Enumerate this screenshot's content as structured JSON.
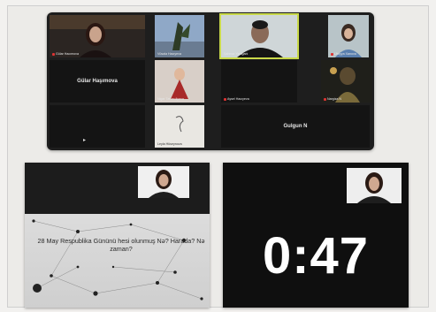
{
  "meeting": {
    "participants": [
      {
        "name": "Gülar Hacımova",
        "video": "person"
      },
      {
        "name": "Vüsala Hacıyeva",
        "video": "plant"
      },
      {
        "name": "Nigar Tarverdiyeva",
        "video": "child"
      },
      {
        "name": "Şahmar Yadigarlı",
        "video": "man-speaking"
      },
      {
        "name": "Gulgun N",
        "video": "off"
      },
      {
        "name": "Ülviyya Xanova",
        "video": "girl"
      },
      {
        "name": "Aysel Hacıyeva",
        "video": "off"
      },
      {
        "name": "Nargiza N",
        "video": "doll"
      },
      {
        "name": "Leyla Hüseynova",
        "video": "sketch"
      }
    ],
    "gular_tile_label": "Gülar Haşımova",
    "gulgun_tile_label": "Gulgun N"
  },
  "slide": {
    "question": "28 May Respublika Gününü hesi olunmuş Nə? Harada? Nə zaman?"
  },
  "timer": {
    "display": "0:47"
  }
}
